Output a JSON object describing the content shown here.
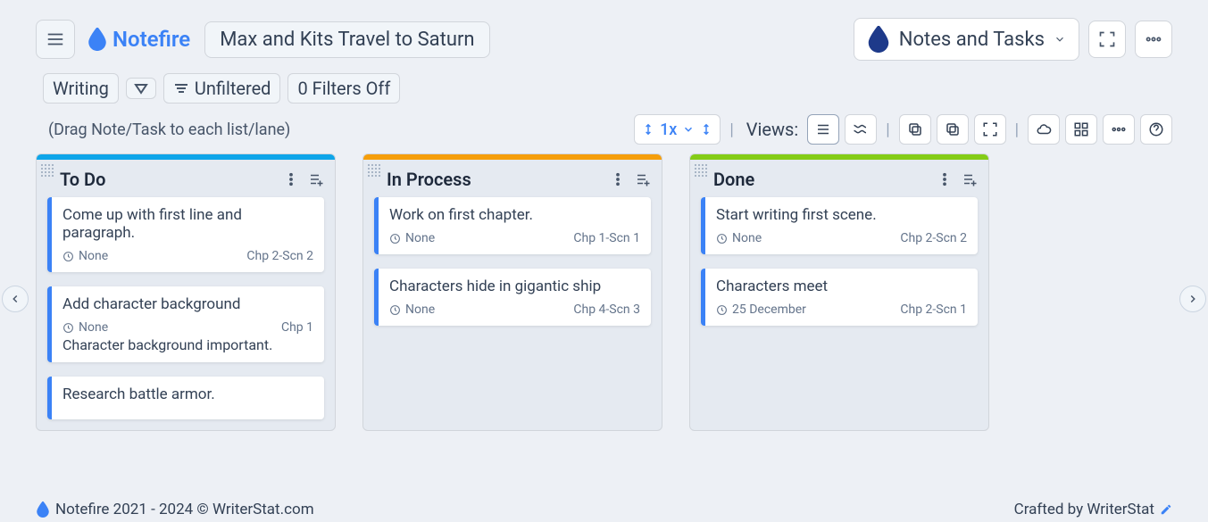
{
  "header": {
    "app_name": "Notefire",
    "project_title": "Max and Kits Travel to Saturn"
  },
  "top_right": {
    "view_selector_label": "Notes and Tasks"
  },
  "filters": {
    "writing_label": "Writing",
    "unfiltered_label": "Unfiltered",
    "filters_label": "0 Filters Off"
  },
  "hint_text": "(Drag Note/Task to each list/lane)",
  "toolbar": {
    "zoom": "1x",
    "views_label": "Views:"
  },
  "lanes": [
    {
      "title": "To Do",
      "color": "blue",
      "cards": [
        {
          "title": "Come up with first line and paragraph.",
          "due": "None",
          "ref": "Chp 2-Scn 2",
          "extra": ""
        },
        {
          "title": "Add character background",
          "due": "None",
          "ref": "Chp 1",
          "extra": "Character background important."
        },
        {
          "title": "Research battle armor.",
          "due": "",
          "ref": "",
          "extra": ""
        }
      ]
    },
    {
      "title": "In Process",
      "color": "orange",
      "cards": [
        {
          "title": "Work on first chapter.",
          "due": "None",
          "ref": "Chp 1-Scn 1",
          "extra": ""
        },
        {
          "title": "Characters hide in gigantic ship",
          "due": "None",
          "ref": "Chp 4-Scn 3",
          "extra": ""
        }
      ]
    },
    {
      "title": "Done",
      "color": "green",
      "cards": [
        {
          "title": "Start writing first scene.",
          "due": "None",
          "ref": "Chp 2-Scn 2",
          "extra": ""
        },
        {
          "title": "Characters meet",
          "due": "25 December",
          "ref": "Chp 2-Scn 1",
          "extra": ""
        }
      ]
    }
  ],
  "footer": {
    "left": "Notefire 2021 - 2024 ©  WriterStat.com",
    "right": "Crafted by WriterStat"
  }
}
